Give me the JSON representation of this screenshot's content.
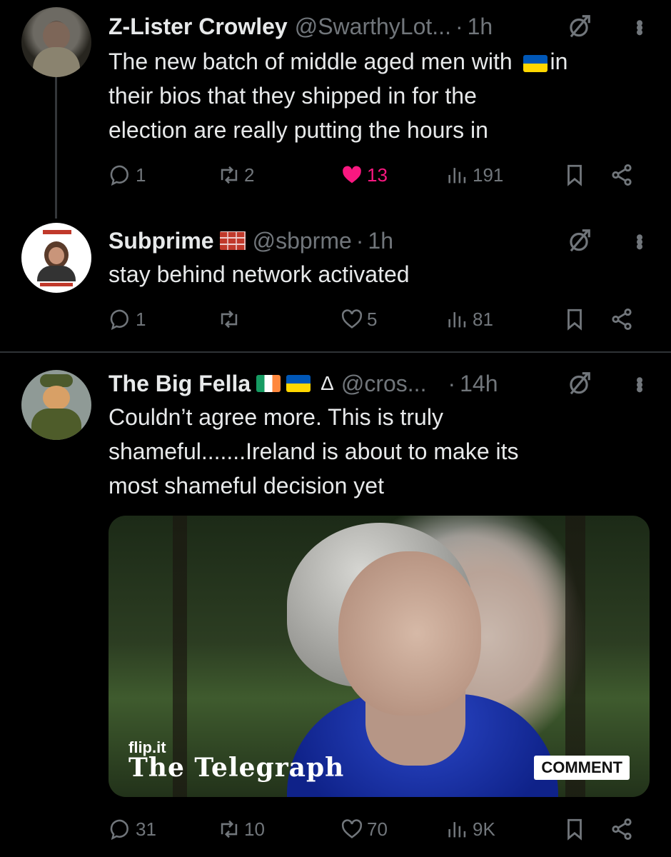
{
  "tweets": [
    {
      "name": "Z-Lister Crowley",
      "handle": "@SwarthyLot...",
      "dot": "·",
      "time": "1h",
      "body": "The new batch of middle aged men with 🇺🇦 in their bios that they shipped in for the election are really putting the hours in",
      "body_parts": [
        "The new batch of middle aged men with",
        "in",
        "their bios that they shipped in for the",
        "election are really putting the hours in"
      ],
      "replies": "1",
      "retweets": "2",
      "likes": "13",
      "views": "191",
      "liked": true
    },
    {
      "name": "Subprime",
      "handle": "@sbprme",
      "dot": "·",
      "time": "1h",
      "body": "stay behind network activated",
      "replies": "1",
      "retweets": "",
      "likes": "5",
      "views": "81",
      "liked": false
    },
    {
      "name": "The Big Fella",
      "handle": "@cros...",
      "dot": "·",
      "time": "14h",
      "triangle": "Δ",
      "body_lines": [
        "Couldn’t agree more.  This is truly",
        "shameful.......Ireland is about to make its",
        "most shameful decision yet"
      ],
      "media": {
        "watermark": "flip.it",
        "publisher": "The Telegraph",
        "badge": "COMMENT"
      },
      "replies": "31",
      "retweets": "10",
      "likes": "70",
      "views": "9K",
      "liked": false
    }
  ],
  "colors": {
    "background": "#000000",
    "text": "#e7e9ea",
    "muted": "#71767b",
    "like": "#f91880"
  },
  "icons": [
    "reply-icon",
    "retweet-icon",
    "heart-icon",
    "views-icon",
    "bookmark-icon",
    "share-icon",
    "mute-icon",
    "more-icon"
  ]
}
